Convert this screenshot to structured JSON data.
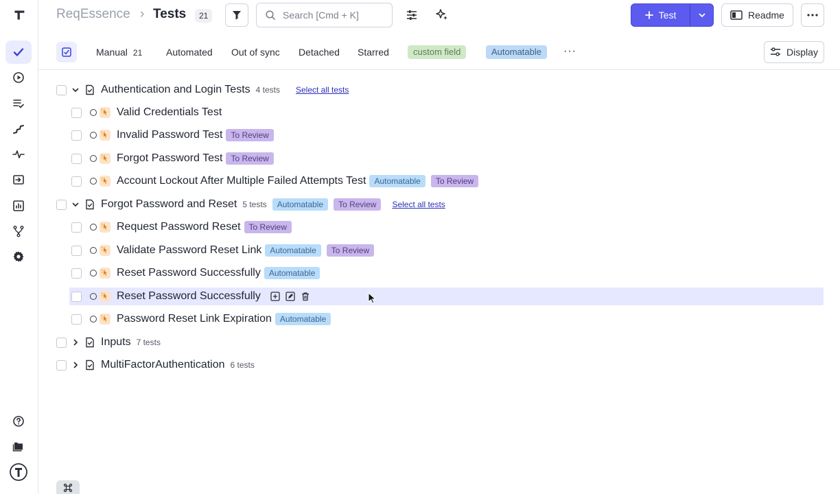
{
  "app": {
    "project_name": "ReqEssence",
    "breadcrumb_separator": "›",
    "current_page": "Tests",
    "test_count": "21"
  },
  "search": {
    "placeholder": "Search [Cmd + K]"
  },
  "header_actions": {
    "new_test_label": "Test",
    "readme_label": "Readme"
  },
  "tabs": {
    "manual": {
      "label": "Manual",
      "count": "21"
    },
    "automated": "Automated",
    "out_of_sync": "Out of sync",
    "detached": "Detached",
    "starred": "Starred",
    "tag_custom_field": "custom field",
    "tag_automatable": "Automatable",
    "more": "···",
    "display_label": "Display"
  },
  "colors": {
    "primary": "#5b5bef",
    "tag_review": "#c8b6ec",
    "tag_automatable": "#b8dcfa",
    "tag_custom": "#cfe9c6",
    "row_hover": "#e5e8ff"
  },
  "tree": {
    "suite1": {
      "title": "Authentication and Login Tests",
      "count": "4 tests",
      "select_all": "Select all tests",
      "tests": [
        {
          "title": "Valid Credentials Test"
        },
        {
          "title": "Invalid Password Test",
          "tag1": "To Review"
        },
        {
          "title": "Forgot Password Test",
          "tag1": "To Review"
        },
        {
          "title": "Account Lockout After Multiple Failed Attempts Test",
          "tag1": "Automatable",
          "tag2": "To Review"
        }
      ]
    },
    "suite2": {
      "title": "Forgot Password and Reset",
      "count": "5 tests",
      "tag1": "Automatable",
      "tag2": "To Review",
      "select_all": "Select all tests",
      "tests": [
        {
          "title": "Request Password Reset",
          "tag1": "To Review"
        },
        {
          "title": "Validate Password Reset Link",
          "tag1": "Automatable",
          "tag2": "To Review"
        },
        {
          "title": "Reset Password Successfully",
          "tag1": "Automatable"
        },
        {
          "title": "Reset Password Successfully"
        },
        {
          "title": "Password Reset Link Expiration",
          "tag1": "Automatable"
        }
      ]
    },
    "suite3": {
      "title": "Inputs",
      "count": "7 tests"
    },
    "suite4": {
      "title": "MultiFactorAuthentication",
      "count": "6 tests"
    }
  }
}
